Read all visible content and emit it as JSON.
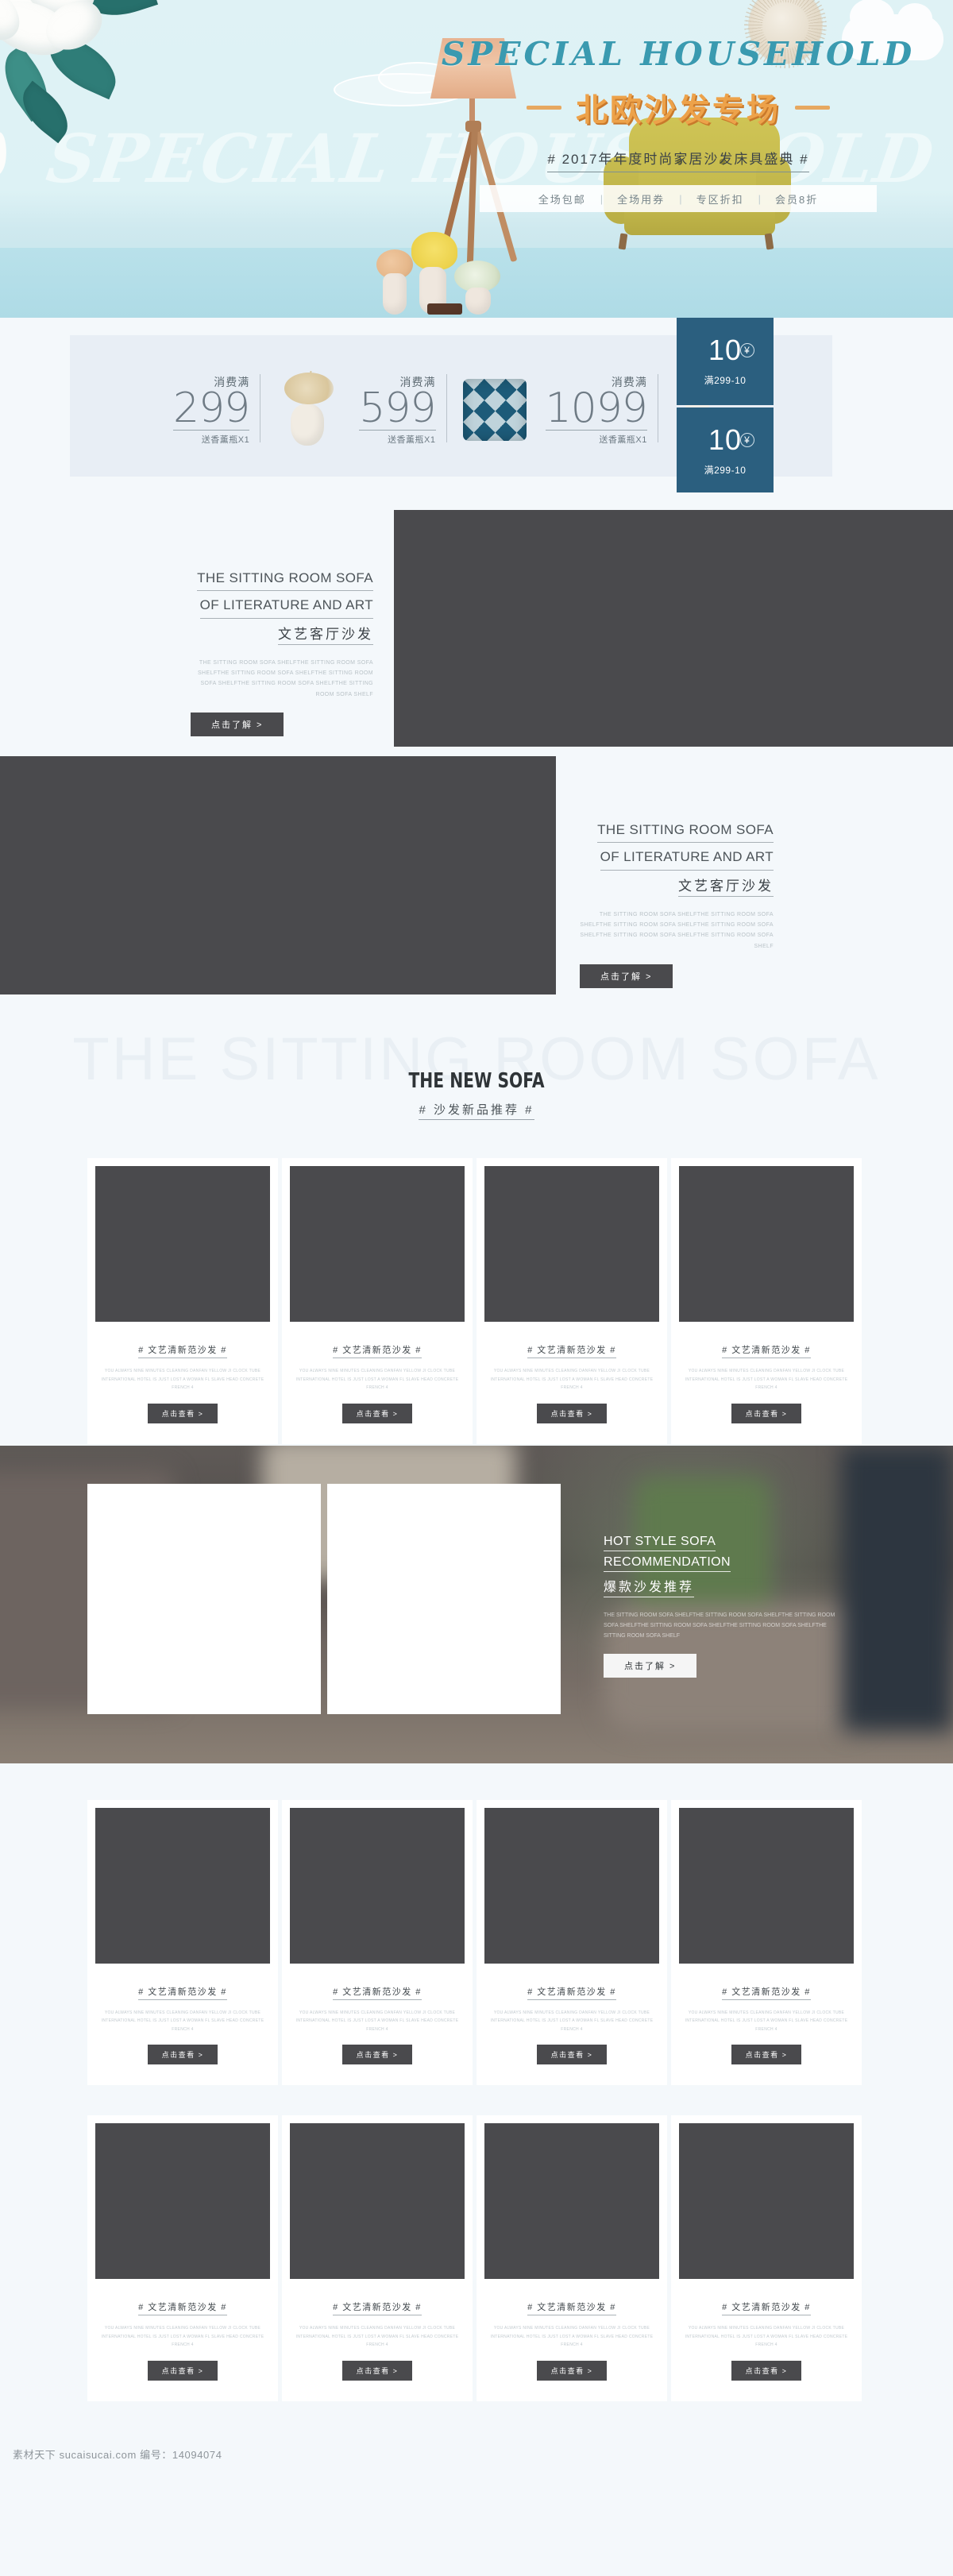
{
  "hero": {
    "ghost_text": "SPECIAL HOUSEHOLD",
    "title_en": "SPECIAL HOUSEHOLD",
    "title_cn": "北欧沙发专场",
    "subtitle": "#  2017年年度时尚家居沙发床具盛典  #",
    "tags": [
      "全场包邮",
      "全场用券",
      "专区折扣",
      "会员8折"
    ],
    "tag_separator": "|",
    "accent_teal": "#3a9ab0",
    "accent_orange": "#eda24a"
  },
  "coupon_bar": {
    "tiers": [
      {
        "label": "消费满",
        "amount": "299",
        "gift": "送香薰瓶X1",
        "gift_icon": "dried-flower-vase-icon"
      },
      {
        "label": "消费满",
        "amount": "599",
        "gift": "送香薰瓶X1",
        "gift_icon": "argyle-pillow-icon"
      },
      {
        "label": "消费满",
        "amount": "1099",
        "gift": "送香薰瓶X1",
        "gift_icon": "white-vase-icon"
      }
    ],
    "coupons": [
      {
        "value": "10",
        "currency": "¥",
        "condition": "满299-10"
      },
      {
        "value": "10",
        "currency": "¥",
        "condition": "满299-10"
      }
    ],
    "coupon_color": "#2b5f7f"
  },
  "features": [
    {
      "line1": "THE SITTING ROOM SOFA",
      "line2": "OF LITERATURE AND ART",
      "line3": "文艺客厅沙发",
      "para": "THE SITTING ROOM SOFA SHELFTHE SITTING ROOM SOFA SHELFTHE SITTING ROOM SOFA SHELFTHE SITTING ROOM SOFA SHELFTHE SITTING ROOM SOFA SHELFTHE SITTING ROOM SOFA SHELF",
      "button": "点击了解 >"
    },
    {
      "line1": "THE SITTING ROOM SOFA",
      "line2": "OF LITERATURE AND ART",
      "line3": "文艺客厅沙发",
      "para": "THE SITTING ROOM SOFA SHELFTHE SITTING ROOM SOFA SHELFTHE SITTING ROOM SOFA SHELFTHE SITTING ROOM SOFA SHELFTHE SITTING ROOM SOFA SHELFTHE SITTING ROOM SOFA SHELF",
      "button": "点击了解 >"
    }
  ],
  "new_sofa": {
    "ghost_text": "THE SITTING ROOM SOFA",
    "title": "THE NEW SOFA",
    "subtitle": "#  沙发新品推荐  #"
  },
  "product": {
    "title": "#  文艺清新范沙发  #",
    "desc": "YOU ALWAYS NINE MINUTES CLEANING DANFAN YELLOW JI CLOCK TUBE INTERNATIONAL HOTEL IS JUST LOST A WOMAN FL SLAVE HEAD CONCRETE FRENCH 4",
    "button": "点击查看 >"
  },
  "product_rows": [
    {
      "cards": [
        1,
        2,
        3,
        4
      ]
    },
    {
      "cards": [
        1,
        2,
        3,
        4
      ]
    },
    {
      "cards": [
        1,
        2,
        3,
        4
      ]
    }
  ],
  "hot_banner": {
    "line1": "HOT STYLE SOFA",
    "line2": "RECOMMENDATION",
    "line3": "爆款沙发推荐",
    "para": "THE SITTING ROOM SOFA SHELFTHE SITTING ROOM SOFA SHELFTHE SITTING ROOM SOFA SHELFTHE SITTING ROOM SOFA SHELFTHE SITTING ROOM SOFA SHELFTHE SITTING ROOM SOFA SHELF",
    "button": "点击了解 >"
  },
  "footer": {
    "text": "素材天下 sucaisucai.com  编号：14094074"
  }
}
